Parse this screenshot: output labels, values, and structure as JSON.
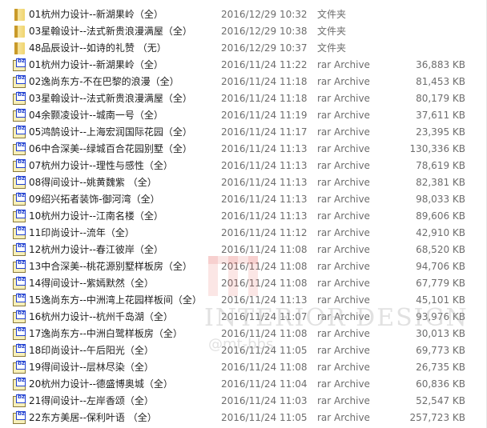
{
  "watermark": {
    "text": "INTERIOR DESIGN",
    "sub": "@mt-bbs"
  },
  "files": [
    {
      "icon": "folder-icon",
      "name": "01杭州力设计--新湖果岭（全）",
      "date": "2016/12/29 10:32",
      "type": "文件夹",
      "size": ""
    },
    {
      "icon": "folder-icon",
      "name": "03星翰设计--法式新贵浪漫满屋（全）",
      "date": "2016/12/29 10:38",
      "type": "文件夹",
      "size": ""
    },
    {
      "icon": "folder-icon",
      "name": "48品辰设计--如诗的礼赞 （无）",
      "date": "2016/12/29 10:37",
      "type": "文件夹",
      "size": ""
    },
    {
      "icon": "rar-archive-icon",
      "name": "01杭州力设计--新湖果岭（全）",
      "date": "2016/11/24 11:22",
      "type": "rar Archive",
      "size": "36,883 KB"
    },
    {
      "icon": "rar-archive-icon",
      "name": "02逸尚东方-不在巴黎的浪漫（全）",
      "date": "2016/11/24 11:18",
      "type": "rar Archive",
      "size": "81,453 KB"
    },
    {
      "icon": "rar-archive-icon",
      "name": "03星翰设计--法式新贵浪漫满屋（全）",
      "date": "2016/11/24 11:18",
      "type": "rar Archive",
      "size": "80,179 KB"
    },
    {
      "icon": "rar-archive-icon",
      "name": "04余颢凌设计--城南一号（全）",
      "date": "2016/11/24 11:19",
      "type": "rar Archive",
      "size": "37,611 KB"
    },
    {
      "icon": "rar-archive-icon",
      "name": "05鸿鹄设计--上海宏润国际花园（全）",
      "date": "2016/11/24 11:17",
      "type": "rar Archive",
      "size": "23,395 KB"
    },
    {
      "icon": "rar-archive-icon",
      "name": "06中合深美--绿城百合花园别墅（全）",
      "date": "2016/11/24 11:13",
      "type": "rar Archive",
      "size": "130,336 KB"
    },
    {
      "icon": "rar-archive-icon",
      "name": "07杭州力设计--理性与感性（全）",
      "date": "2016/11/24 11:13",
      "type": "rar Archive",
      "size": "78,619 KB"
    },
    {
      "icon": "rar-archive-icon",
      "name": "08得间设计--姚黄魏紫 （全）",
      "date": "2016/11/24 11:13",
      "type": "rar Archive",
      "size": "82,381 KB"
    },
    {
      "icon": "rar-archive-icon",
      "name": "09绍兴拓者装饰-御河湾（全）",
      "date": "2016/11/24 11:13",
      "type": "rar Archive",
      "size": "98,033 KB"
    },
    {
      "icon": "rar-archive-icon",
      "name": "10杭州力设计--江南名楼（全）",
      "date": "2016/11/24 11:13",
      "type": "rar Archive",
      "size": "89,606 KB"
    },
    {
      "icon": "rar-archive-icon",
      "name": "11印尚设计--流年（全）",
      "date": "2016/11/24 11:12",
      "type": "rar Archive",
      "size": "42,910 KB"
    },
    {
      "icon": "rar-archive-icon",
      "name": "12杭州力设计--春江彼岸（全）",
      "date": "2016/11/24 11:08",
      "type": "rar Archive",
      "size": "68,520 KB"
    },
    {
      "icon": "rar-archive-icon",
      "name": "13中合深美--桃花源别墅样板房（全）",
      "date": "2016/11/24 11:08",
      "type": "rar Archive",
      "size": "94,706 KB"
    },
    {
      "icon": "rar-archive-icon",
      "name": "14得间设计--紫嫣默然（全）",
      "date": "2016/11/24 11:08",
      "type": "rar Archive",
      "size": "67,779 KB"
    },
    {
      "icon": "rar-archive-icon",
      "name": "15逸尚东方--中洲湾上花园样板间（全）",
      "date": "2016/11/24 11:13",
      "type": "rar Archive",
      "size": "45,101 KB"
    },
    {
      "icon": "rar-archive-icon",
      "name": "16杭州力设计--杭州千岛湖（全）",
      "date": "2016/11/24 11:07",
      "type": "rar Archive",
      "size": "93,976 KB"
    },
    {
      "icon": "rar-archive-icon",
      "name": "17逸尚东方--中洲白鹭样板房（全）",
      "date": "2016/11/24 11:08",
      "type": "rar Archive",
      "size": "30,013 KB"
    },
    {
      "icon": "rar-archive-icon",
      "name": "18印尚设计--午后阳光（全）",
      "date": "2016/11/24 11:05",
      "type": "rar Archive",
      "size": "69,773 KB"
    },
    {
      "icon": "rar-archive-icon",
      "name": "19得间设计--层林尽染（全）",
      "date": "2016/11/24 11:08",
      "type": "rar Archive",
      "size": "26,735 KB"
    },
    {
      "icon": "rar-archive-icon",
      "name": "20杭州力设计--德盛博奥城（全）",
      "date": "2016/11/24 11:04",
      "type": "rar Archive",
      "size": "60,836 KB"
    },
    {
      "icon": "rar-archive-icon",
      "name": "21得间设计--左岸香颂（全）",
      "date": "2016/11/24 11:03",
      "type": "rar Archive",
      "size": "52,547 KB"
    },
    {
      "icon": "rar-archive-icon",
      "name": "22东方美居--保利叶语 （全）",
      "date": "2016/11/24 11:05",
      "type": "rar Archive",
      "size": "257,723 KB"
    }
  ]
}
